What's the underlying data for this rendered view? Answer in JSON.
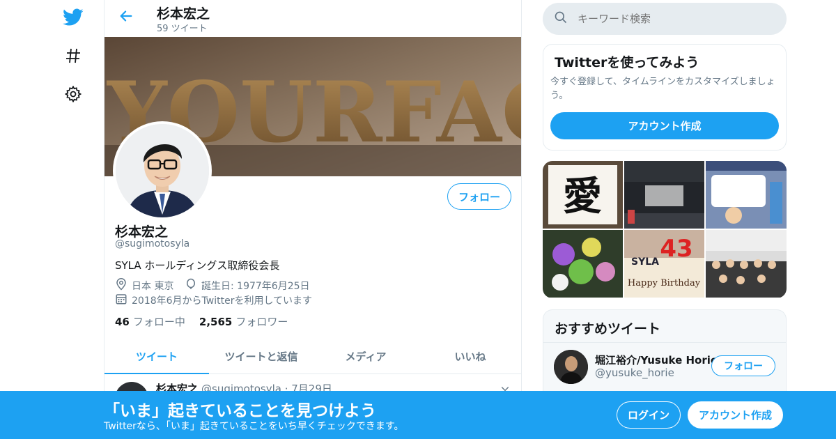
{
  "nav": {
    "icons": [
      "twitter-bird-icon",
      "hashtag-icon",
      "gear-icon"
    ]
  },
  "header": {
    "name": "杉本宏之",
    "tweet_count": "59 ツイート"
  },
  "profile": {
    "name": "杉本宏之",
    "handle": "@sugimotosyla",
    "bio": "SYLA ホールディングス取締役会長",
    "location": "日本 東京",
    "birthday": "誕生日: 1977年6月25日",
    "joined": "2018年6月からTwitterを利用しています",
    "following_count": "46",
    "following_label": "フォロー中",
    "followers_count": "2,565",
    "followers_label": "フォロワー",
    "follow_label": "フォロー",
    "banner_text": "YOURFACE"
  },
  "tabs": [
    {
      "label": "ツイート",
      "active": true
    },
    {
      "label": "ツイートと返信",
      "active": false
    },
    {
      "label": "メディア",
      "active": false
    },
    {
      "label": "いいね",
      "active": false
    }
  ],
  "tweet_preview": {
    "name": "杉本宏之",
    "meta": "@sugimotosyla · 7月29日"
  },
  "search": {
    "placeholder": "キーワード検索"
  },
  "signup_card": {
    "title": "Twitterを使ってみよう",
    "text": "今すぐ登録して、タイムラインをカスタマイズしましょう。",
    "button": "アカウント作成"
  },
  "photos": {
    "calligraphy_char": "愛",
    "cake_text": "43",
    "cake_brand": "SYLA",
    "cake_message": "Happy Birthday"
  },
  "recommended": {
    "title": "おすすめツイート",
    "items": [
      {
        "name": "堀江裕介/Yusuke Horie",
        "handle": "@yusuke_horie",
        "button": "フォロー"
      }
    ]
  },
  "bottom_bar": {
    "title": "「いま」起きていることを見つけよう",
    "subtitle": "Twitterなら、「いま」起きていることをいち早くチェックできます。",
    "login": "ログイン",
    "signup": "アカウント作成"
  },
  "colors": {
    "accent": "#1da1f2",
    "text": "#14171a",
    "secondary_text": "#657786",
    "border": "#e6ecf0"
  }
}
